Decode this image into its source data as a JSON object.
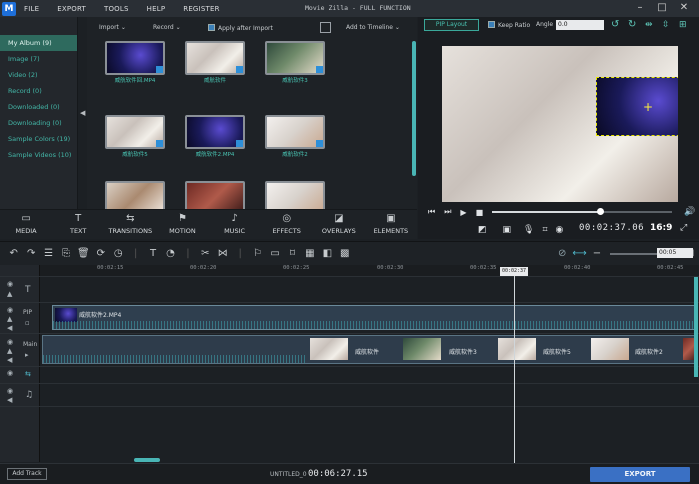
{
  "app": {
    "title": "Movie Zilla - FULL FUNCTION",
    "logo": "M"
  },
  "menu": [
    "FILE",
    "EXPORT",
    "TOOLS",
    "HELP",
    "REGISTER"
  ],
  "window_buttons": [
    "–",
    "□",
    "✕"
  ],
  "sidebar": {
    "items": [
      {
        "label": "My Album (9)",
        "active": true
      },
      {
        "label": "Image (7)"
      },
      {
        "label": "Video (2)"
      },
      {
        "label": "Record (0)"
      },
      {
        "label": "Downloaded (0)"
      },
      {
        "label": "Downloading (0)"
      },
      {
        "label": "Sample Colors (19)"
      },
      {
        "label": "Sample Videos (10)"
      }
    ]
  },
  "media_toolbar": {
    "import": "Import",
    "record": "Record",
    "apply_after_import": "Apply after Import",
    "add_to_timeline": "Add to Timeline"
  },
  "media_items": [
    {
      "caption": "威航软件回.MP4",
      "style": "ph-blue"
    },
    {
      "caption": "威航软件",
      "style": "ph-bed"
    },
    {
      "caption": "威航软件3",
      "style": "ph-green"
    },
    {
      "caption": "威航软件5",
      "style": "ph-bed"
    },
    {
      "caption": "威航软件2.MP4",
      "style": "ph-blue"
    },
    {
      "caption": "威航软件2",
      "style": "ph-white"
    },
    {
      "caption": "",
      "style": "ph-room"
    },
    {
      "caption": "",
      "style": "ph-red"
    },
    {
      "caption": "",
      "style": "ph-white"
    }
  ],
  "categories": [
    {
      "label": "MEDIA",
      "icon": "folder-icon"
    },
    {
      "label": "TEXT",
      "icon": "text-icon"
    },
    {
      "label": "TRANSITIONS",
      "icon": "transitions-icon"
    },
    {
      "label": "MOTION",
      "icon": "motion-icon"
    },
    {
      "label": "MUSIC",
      "icon": "music-icon"
    },
    {
      "label": "EFFECTS",
      "icon": "effects-icon"
    },
    {
      "label": "OVERLAYS",
      "icon": "overlays-icon"
    },
    {
      "label": "ELEMENTS",
      "icon": "elements-icon"
    }
  ],
  "preview": {
    "pip_layout": "PIP Layout",
    "keep_ratio": "Keep Ratio",
    "angle_label": "Angle",
    "angle_value": "0.0",
    "time": "00:02:37.06",
    "ratio": "16:9",
    "progress": 0.6
  },
  "timeline": {
    "ruler": [
      "00:02:15",
      "00:02:20",
      "00:02:25",
      "00:02:30",
      "00:02:35",
      "00:02:40",
      "00:02:45"
    ],
    "playhead": "00:02:37",
    "zoom": "00:05",
    "tracks": [
      {
        "label": ""
      },
      {
        "label": "PIP"
      },
      {
        "label": "Main"
      },
      {
        "label": ""
      },
      {
        "label": ""
      }
    ],
    "pip_clip": "威航软件2.MP4",
    "main_clips": [
      "威航软件",
      "威航软件3",
      "威航软件5",
      "威航软件2"
    ]
  },
  "footer": {
    "add_track": "Add Track",
    "project": "UNTITLED_0",
    "duration": "00:06:27.15",
    "export": "EXPORT"
  }
}
